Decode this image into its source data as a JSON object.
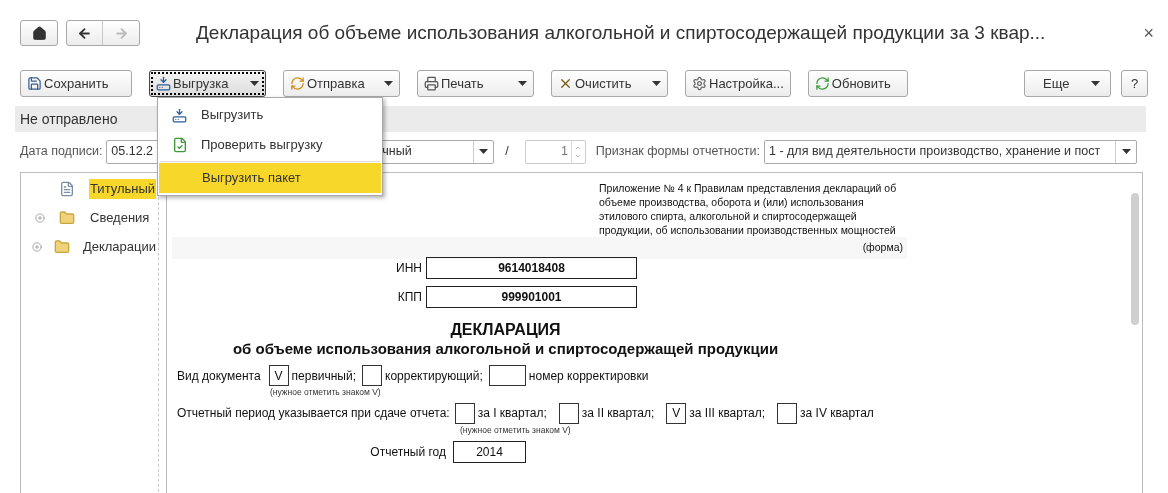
{
  "header": {
    "title": "Декларация об объеме использования алкогольной и спиртосодержащей продукции за 3 квар...",
    "close": "×"
  },
  "toolbar": {
    "buttons": [
      {
        "label": "Сохранить",
        "dropdown": false,
        "focused": false
      },
      {
        "label": "Выгрузка",
        "dropdown": true,
        "focused": true
      },
      {
        "label": "Отправка",
        "dropdown": true,
        "focused": false
      },
      {
        "label": "Печать",
        "dropdown": true,
        "focused": false
      },
      {
        "label": "Очистить",
        "dropdown": true,
        "focused": false
      },
      {
        "label": "Настройка...",
        "dropdown": false,
        "focused": false
      },
      {
        "label": "Обновить",
        "dropdown": false,
        "focused": false
      }
    ],
    "more": "Еще",
    "help": "?"
  },
  "status": "Не отправлено",
  "params": {
    "date_label": "Дата подписи:",
    "date_value": "05.12.2",
    "type_value": "чный",
    "slash": "/",
    "number_value": "1",
    "form_label": "Признак формы отчетности:",
    "form_value": "1 - для вид деятельности производство, хранение и пост"
  },
  "menu": {
    "items": [
      {
        "label": "Выгрузить",
        "selected": false
      },
      {
        "label": "Проверить выгрузку",
        "selected": false
      },
      {
        "label": "Выгрузить пакет",
        "selected": true
      }
    ]
  },
  "tree": [
    {
      "label": "Титульный",
      "kind": "doc",
      "selected": true
    },
    {
      "label": "Сведения",
      "kind": "folder",
      "selected": false,
      "expanded": false
    },
    {
      "label": "Декларации",
      "kind": "folder",
      "selected": false,
      "expanded": false
    }
  ],
  "document": {
    "annex": "Приложение № 4 к Правилам представления деклараций об объеме производства, оборота и (или) использования этилового спирта, алкогольной и спиртосодержащей продукции, об использовании производственных мощностей",
    "form_note": "(форма)",
    "ids": [
      {
        "label": "ИНН",
        "value": "9614018408"
      },
      {
        "label": "КПП",
        "value": "999901001"
      }
    ],
    "heading": "ДЕКЛАРАЦИЯ",
    "subheading": "об объеме использования алкогольной и спиртосодержащей продукции",
    "doc_type": {
      "label": "Вид документа",
      "options": [
        {
          "label": "первичный;",
          "mark": "V"
        },
        {
          "label": "корректирующий;"
        }
      ],
      "number_label": "номер корректировки",
      "hint": "(нужное отметить знаком V)"
    },
    "period": {
      "label": "Отчетный период указывается при сдаче отчета:",
      "options": [
        {
          "label": "за I квартал;"
        },
        {
          "label": "за II квартал;"
        },
        {
          "label": "за III квартал;",
          "mark": "V"
        },
        {
          "label": "за IV квартал"
        }
      ],
      "hint": "(нужное отметить знаком V)"
    },
    "year": {
      "label": "Отчетный год",
      "value": "2014"
    }
  }
}
